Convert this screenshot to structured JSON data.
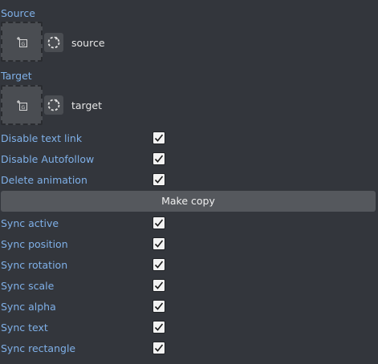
{
  "source": {
    "label": "Source",
    "name": "source",
    "drop_icon": "add-layer-icon",
    "reset_icon": "reset-circle-icon"
  },
  "target": {
    "label": "Target",
    "name": "target",
    "drop_icon": "add-layer-icon",
    "reset_icon": "reset-circle-icon"
  },
  "options_top": [
    {
      "label": "Disable text link",
      "checked": true
    },
    {
      "label": "Disable Autofollow",
      "checked": true
    },
    {
      "label": "Delete animation",
      "checked": true
    }
  ],
  "make_copy_label": "Make copy",
  "sync_options": [
    {
      "label": "Sync active",
      "checked": true
    },
    {
      "label": "Sync position",
      "checked": true
    },
    {
      "label": "Sync rotation",
      "checked": true
    },
    {
      "label": "Sync scale",
      "checked": true
    },
    {
      "label": "Sync alpha",
      "checked": true
    },
    {
      "label": "Sync text",
      "checked": true
    },
    {
      "label": "Sync rectangle",
      "checked": true
    }
  ],
  "colors": {
    "background": "#33363c",
    "label": "#7fb0e8",
    "text": "#e6e6e6",
    "button": "#55585d",
    "checkbox": "#f2f2f2"
  }
}
